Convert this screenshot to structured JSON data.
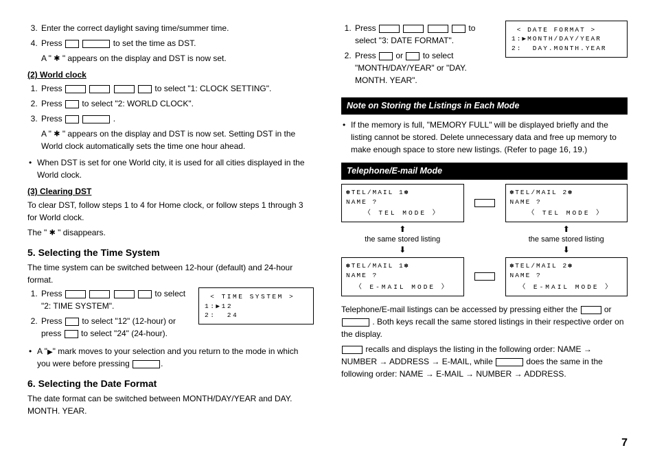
{
  "left": {
    "step3": "Enter the correct daylight saving time/summer time.",
    "step4a": "Press ",
    "step4b": " to set the time as DST.",
    "step4_sub_a": "A \" ",
    "step4_sub_b": " \" appears on the display and DST is now set.",
    "wc_title": "(2)  World clock",
    "wc1a": "Press ",
    "wc1b": " to select \"1: CLOCK SETTING\".",
    "wc2a": "Press ",
    "wc2b": " to select \"2: WORLD CLOCK\".",
    "wc3a": "Press ",
    "wc3b": " .",
    "wc3_sub_a": "A \" ",
    "wc3_sub_b": " \" appears on the display and DST is now set. Setting DST in the World clock automatically sets the time one hour ahead.",
    "wc_bullet": "When DST is set for one World city, it is used for all cities displayed in the World clock.",
    "clr_title": "(3)  Clearing DST",
    "clr_p": "To clear DST, follow steps 1 to 4 for Home clock, or follow steps 1 through 3 for World clock.",
    "clr_p2a": "The \" ",
    "clr_p2b": " \" disappears.",
    "ts_heading": "5. Selecting the Time System",
    "ts_p": "The time system can be switched between 12-hour (default) and 24-hour format.",
    "ts1a": "Press ",
    "ts1b": " to select \"2: TIME SYSTEM\".",
    "ts2a": "Press ",
    "ts2b": " to select \"12\" (12-hour) or press ",
    "ts2c": " to select \"24\" (24-hour).",
    "ts_bullet_a": "A \"",
    "ts_bullet_b": "\" mark moves to your selection and you return to the mode in which you were before pressing ",
    "ts_bullet_c": ".",
    "ts_lcd": " < TIME SYSTEM >\n1:▶12\n2:  24",
    "df_heading": "6. Selecting the Date Format",
    "df_p": "The date format can be switched between MONTH/DAY/YEAR and DAY. MONTH. YEAR."
  },
  "right": {
    "r1a": "Press ",
    "r1b": " to select \"3: DATE FORMAT\".",
    "r2a": "Press ",
    "r2b": " or ",
    "r2c": " to select \"MONTH/DAY/YEAR\" or \"DAY. MONTH. YEAR\".",
    "r_lcd": " < DATE FORMAT >\n1:▶MONTH/DAY/YEAR\n2:  DAY.MONTH.YEAR",
    "note_bar": "Note on Storing the Listings in Each Mode",
    "note_bul": "If the memory is full, \"MEMORY FULL\" will be displayed briefly and the listing cannot be stored. Delete unnecessary data and free up memory to make enough space to store new listings. (Refer to page 16, 19.)",
    "tel_bar": "Telephone/E-mail Mode",
    "lcd1_l1": "✽TEL/MAIL 1✽",
    "lcd1_l2": "NAME ?",
    "lcd1_l3": "〈 TEL MODE 〉",
    "lcd2_l1": "✽TEL/MAIL 2✽",
    "lcd2_l2": "NAME ?",
    "lcd2_l3": "〈 TEL MODE 〉",
    "lcd3_l1": "✽TEL/MAIL 1✽",
    "lcd3_l2": "NAME ?",
    "lcd3_l3": "〈 E-MAIL MODE 〉",
    "lcd4_l1": "✽TEL/MAIL 2✽",
    "lcd4_l2": "NAME ?",
    "lcd4_l3": "〈 E-MAIL MODE 〉",
    "same": "the same stored listing",
    "tel_p1a": "Telephone/E-mail listings can be accessed by pressing either the ",
    "tel_p1b": " or ",
    "tel_p1c": ". Both keys recall the same stored listings in their respective order on the display.",
    "tel_p2a": " recalls and displays the listing in the following order: NAME ",
    "arrow": "→",
    "tel_p2b": " NUMBER ",
    "tel_p2c": " ADDRESS ",
    "tel_p2d": " E-MAIL, while ",
    "tel_p2e": " does the same in the following order: NAME ",
    "tel_p2f": " E-MAIL ",
    "tel_p2g": " NUMBER ",
    "tel_p2h": " ADDRESS."
  },
  "pagenum": "7"
}
